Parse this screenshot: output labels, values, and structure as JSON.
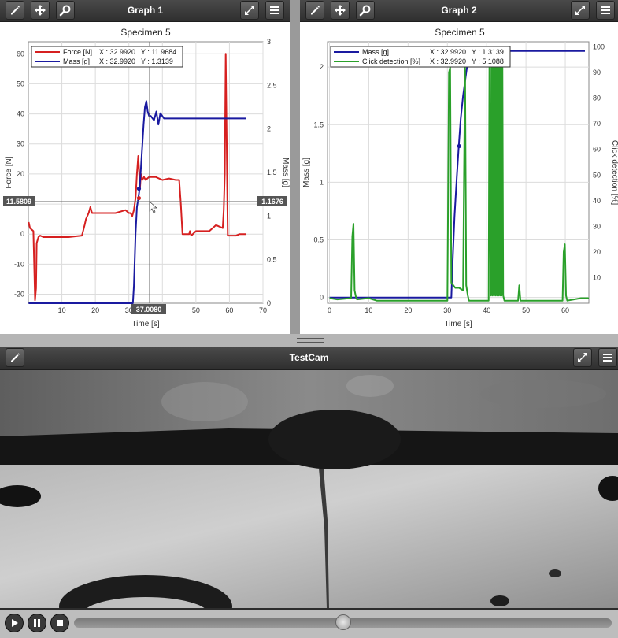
{
  "graph1": {
    "title": "Graph 1",
    "chart_title": "Specimen 5",
    "legend": [
      {
        "name": "Force [N]",
        "x_readout": "X : 32.9920",
        "y_readout": "Y : 11.9684",
        "color": "#d62020"
      },
      {
        "name": "Mass [g]",
        "x_readout": "X : 32.9920",
        "y_readout": "Y : 1.3139",
        "color": "#1a1aa0"
      }
    ],
    "xlabel": "Time [s]",
    "ylabel_left": "Force [N]",
    "ylabel_right": "Mass [g]",
    "x_ticks": [
      "10",
      "20",
      "30",
      "40",
      "50",
      "60",
      "70"
    ],
    "y_left_ticks": [
      "60",
      "50",
      "40",
      "30",
      "20",
      "10",
      "0",
      "-10",
      "-20"
    ],
    "y_right_ticks": [
      "3",
      "2.5",
      "2",
      "1.5",
      "1",
      "0.5",
      "0"
    ],
    "cursor_left_readout": "11.5809",
    "cursor_right_readout": "1.1676",
    "cursor_x_readout": "37.0080"
  },
  "graph2": {
    "title": "Graph 2",
    "chart_title": "Specimen 5",
    "legend": [
      {
        "name": "Mass [g]",
        "x_readout": "X : 32.9920",
        "y_readout": "Y : 1.3139",
        "color": "#1a1aa0"
      },
      {
        "name": "Click detection [%]",
        "x_readout": "X : 32.9920",
        "y_readout": "Y : 5.1088",
        "color": "#2aa02a"
      }
    ],
    "xlabel": "Time [s]",
    "ylabel_left": "Mass [g]",
    "ylabel_right": "Click detection [%]",
    "x_ticks": [
      "0",
      "10",
      "20",
      "30",
      "40",
      "50",
      "60"
    ],
    "y_left_ticks": [
      "2",
      "1.5",
      "1",
      "0.5",
      "0"
    ],
    "y_right_ticks": [
      "100",
      "90",
      "80",
      "70",
      "60",
      "50",
      "40",
      "30",
      "20",
      "10"
    ]
  },
  "camera": {
    "title": "TestCam",
    "playback_position": 0.5
  },
  "icons": {
    "edit": "pencil-icon",
    "pan": "move-arrows-icon",
    "zoom": "magnifier-icon",
    "fullscreen": "expand-icon",
    "menu": "hamburger-menu-icon",
    "play": "play-icon",
    "pause": "pause-icon",
    "stop": "stop-icon"
  },
  "chart_data": [
    {
      "type": "line",
      "title": "Specimen 5",
      "xlabel": "Time [s]",
      "ylabel": "Force [N]",
      "y2label": "Mass [g]",
      "xlim": [
        0,
        70
      ],
      "ylim": [
        -23,
        64
      ],
      "y2lim": [
        0,
        3
      ],
      "grid": true,
      "legend_position": "top-left",
      "series": [
        {
          "name": "Force [N]",
          "axis": "left",
          "color": "#d62020",
          "x": [
            0.1,
            0.5,
            1.5,
            2.0,
            2.3,
            2.5,
            3.0,
            3.5,
            4.5,
            8,
            12,
            16,
            16.8,
            17.2,
            18,
            18.5,
            19,
            22,
            26,
            29,
            30,
            30.5,
            31,
            31.5,
            32,
            32.4,
            32.8,
            33,
            33.3,
            33.6,
            34,
            34.5,
            35,
            36,
            38,
            40,
            42,
            44,
            45,
            45.5,
            46,
            48,
            48.2,
            48.6,
            50,
            54,
            56,
            58,
            58.3,
            58.6,
            58.9,
            59.2,
            59.5,
            60,
            62,
            63,
            64,
            65
          ],
          "y": [
            4,
            2,
            1,
            -22,
            -18,
            -3,
            -1,
            -0.5,
            -1,
            -1,
            -1,
            -0.5,
            3,
            5,
            7,
            9,
            7,
            7,
            7,
            8,
            7,
            7,
            6,
            8,
            12,
            20,
            26,
            22,
            15,
            20,
            18,
            19,
            18,
            19,
            19,
            18,
            18.5,
            18,
            18,
            10,
            0,
            0,
            1,
            -0.5,
            1,
            1,
            3,
            2,
            8,
            20,
            60,
            30,
            -0.5,
            -0.5,
            -0.5,
            0,
            0,
            0
          ]
        },
        {
          "name": "Mass [g]",
          "axis": "right",
          "color": "#1a1aa0",
          "x": [
            0.1,
            10,
            20,
            31.2,
            31.5,
            32,
            32.4,
            32.8,
            33.2,
            33.6,
            34,
            34.4,
            34.8,
            35.2,
            35.6,
            36,
            36.5,
            37.5,
            38.2,
            38.8,
            39.4,
            40.5,
            45,
            55,
            65
          ],
          "y": [
            0,
            0,
            0,
            0,
            0.2,
            0.8,
            1.1,
            1.2,
            1.31,
            1.55,
            1.8,
            2.05,
            2.25,
            2.32,
            2.2,
            2.15,
            2.15,
            2.1,
            2.2,
            2.05,
            2.18,
            2.12,
            2.12,
            2.12,
            2.12
          ]
        }
      ]
    },
    {
      "type": "line",
      "title": "Specimen 5",
      "xlabel": "Time [s]",
      "ylabel": "Mass [g]",
      "y2label": "Click detection [%]",
      "xlim": [
        -0.5,
        66
      ],
      "ylim": [
        -0.05,
        2.22
      ],
      "y2lim": [
        0,
        102
      ],
      "grid": true,
      "legend_position": "top-left",
      "series": [
        {
          "name": "Mass [g]",
          "axis": "left",
          "color": "#1a1aa0",
          "x": [
            0,
            5,
            10,
            20,
            31,
            31.2,
            31.8,
            32.4,
            32.9,
            33.4,
            34,
            34.6,
            35,
            35.4,
            35.8,
            36.4,
            38,
            40,
            44,
            50,
            60,
            65
          ],
          "y": [
            0,
            0,
            0,
            0,
            0,
            0.2,
            0.7,
            1.05,
            1.31,
            1.55,
            1.75,
            1.9,
            2.0,
            2.06,
            2.11,
            2.14,
            2.14,
            2.14,
            2.14,
            2.14,
            2.14,
            2.14
          ]
        },
        {
          "name": "Click detection [%]",
          "axis": "right",
          "color": "#2aa02a",
          "x": [
            0,
            2,
            5.5,
            5.8,
            6.1,
            6.4,
            6.8,
            7,
            10,
            12,
            20,
            30,
            30.4,
            30.7,
            31,
            32,
            33,
            34,
            34.5,
            34.8,
            35.2,
            35.5,
            36,
            40.5,
            40.7,
            41,
            41.2,
            41.4,
            41.6,
            41.8,
            42,
            42.2,
            42.4,
            42.6,
            42.8,
            43,
            43.2,
            43.4,
            43.6,
            43.8,
            44,
            44.2,
            44.5,
            45,
            48,
            48.3,
            48.6,
            50,
            55,
            59.3,
            59.6,
            59.9,
            60.2,
            60.5,
            64,
            66
          ],
          "y": [
            2,
            1.5,
            2,
            26,
            31,
            5,
            2,
            1.5,
            2,
            1,
            1,
            1,
            90,
            92,
            8,
            6,
            6,
            5,
            95,
            7,
            3,
            1,
            1,
            1,
            95,
            3,
            95,
            3,
            95,
            3,
            95,
            3,
            95,
            3,
            95,
            3,
            95,
            3,
            95,
            3,
            95,
            3,
            1,
            1,
            1,
            7,
            1,
            1,
            1,
            1,
            20,
            23,
            3,
            1,
            2,
            2
          ]
        }
      ]
    }
  ]
}
